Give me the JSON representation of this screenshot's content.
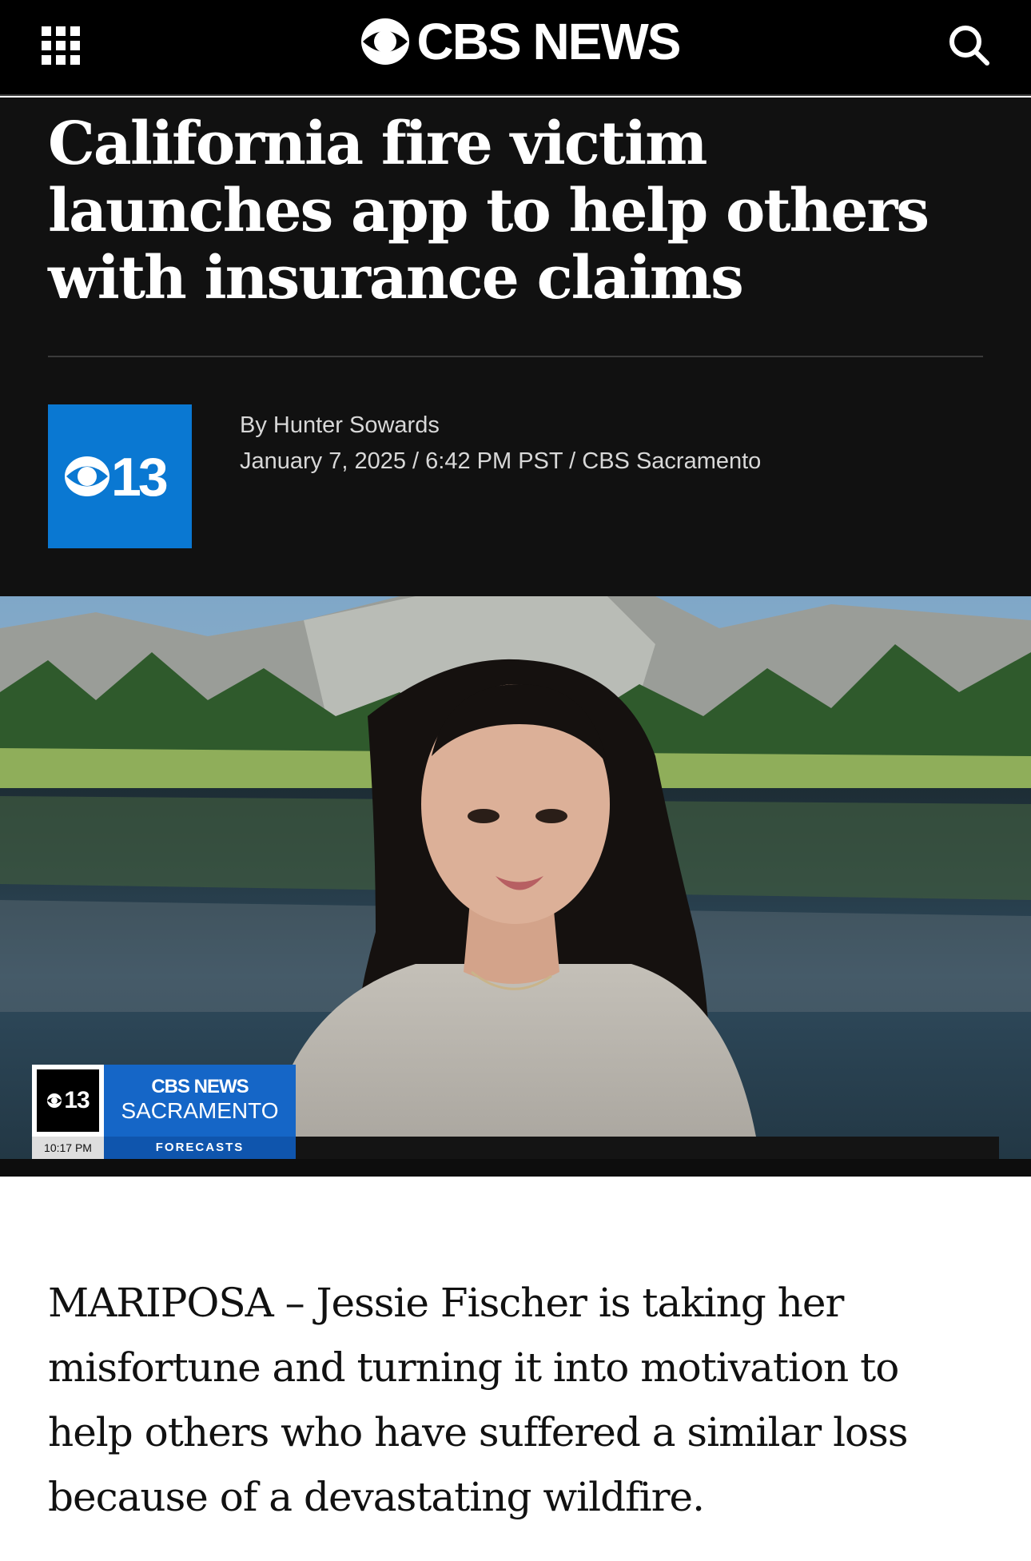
{
  "nav": {
    "brand": "CBS NEWS",
    "menu_icon": "grid-menu-icon",
    "search_icon": "search-icon"
  },
  "article": {
    "headline": "California fire victim launches app to help others with insurance claims",
    "station_logo_text": "13",
    "author": "By Hunter Sowards",
    "dateline": "January 7, 2025 / 6:42 PM PST / CBS Sacramento"
  },
  "video": {
    "overlay_logo_text": "13",
    "overlay_brand": "CBS NEWS",
    "overlay_station": "SACRAMENTO",
    "time": "10:17 PM",
    "section": "FORECASTS"
  },
  "body": {
    "paragraph_1": "MARIPOSA – Jessie Fischer is taking her misfortune and turning it into motivation to help others who have suffered a similar loss because of a devastating wildfire."
  },
  "colors": {
    "nav_bg": "#000000",
    "header_bg": "#111111",
    "station_blue": "#0a78d2",
    "overlay_blue": "#1566c7"
  }
}
